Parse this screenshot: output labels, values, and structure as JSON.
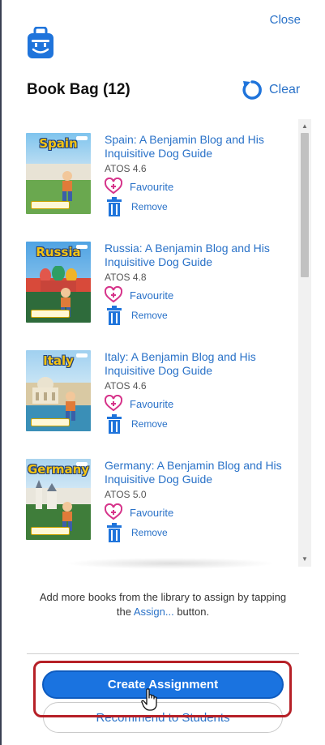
{
  "header": {
    "close_label": "Close",
    "title": "Book Bag (12)",
    "clear_label": "Clear",
    "bag_icon": "book-bag-icon",
    "clear_icon": "refresh-icon"
  },
  "books": [
    {
      "title": "Spain: A Benjamin Blog and His Inquisitive Dog Guide",
      "atos": "ATOS 4.6",
      "favourite_label": "Favourite",
      "remove_label": "Remove",
      "cover_text": "Spain",
      "cover_colors": {
        "sky": "#7fc4ee",
        "ground": "#6aa84f",
        "accent": "#e8e3d5"
      }
    },
    {
      "title": "Russia: A Benjamin Blog and His Inquisitive Dog Guide",
      "atos": "ATOS 4.8",
      "favourite_label": "Favourite",
      "remove_label": "Remove",
      "cover_text": "Russia",
      "cover_colors": {
        "sky": "#4fa3e3",
        "ground": "#2e6b3b",
        "accent": "#d84a3a"
      }
    },
    {
      "title": "Italy: A Benjamin Blog and His Inquisitive Dog Guide",
      "atos": "ATOS 4.6",
      "favourite_label": "Favourite",
      "remove_label": "Remove",
      "cover_text": "Italy",
      "cover_colors": {
        "sky": "#9fd0f0",
        "ground": "#3a8fb7",
        "accent": "#d9c9a3"
      }
    },
    {
      "title": "Germany: A Benjamin Blog and His Inquisitive Dog Guide",
      "atos": "ATOS 5.0",
      "favourite_label": "Favourite",
      "remove_label": "Remove",
      "cover_text": "Germany",
      "cover_colors": {
        "sky": "#a9d3ee",
        "ground": "#3f7d3a",
        "accent": "#e9e6dc"
      }
    }
  ],
  "footer": {
    "hint_before": "Add more books from the library to assign by tapping the ",
    "hint_link": "Assign...",
    "hint_after": " button.",
    "create_label": "Create Assignment",
    "recommend_label": "Recommend to Students"
  },
  "colors": {
    "link_blue": "#2a72c8",
    "primary_button": "#1a73e0",
    "favourite_pink": "#d6338a",
    "highlight_red": "#b62027"
  }
}
